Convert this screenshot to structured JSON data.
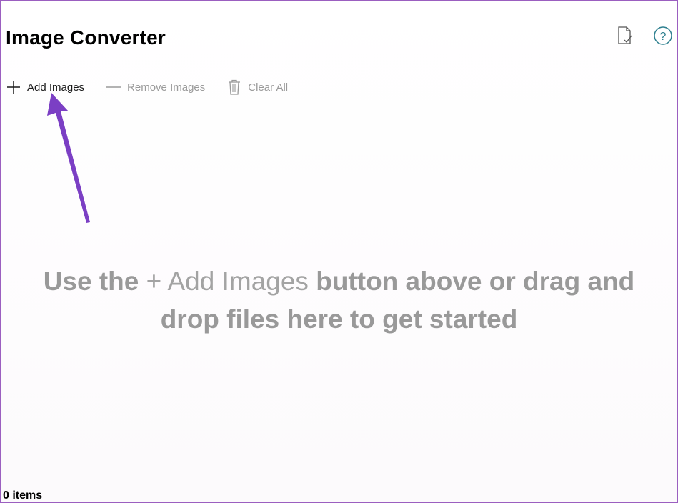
{
  "app": {
    "title": "Image Converter"
  },
  "header": {
    "icons": [
      "document-icon",
      "help-icon"
    ]
  },
  "toolbar": {
    "add_label": "Add Images",
    "remove_label": "Remove Images",
    "clear_label": "Clear All",
    "add_enabled": true,
    "remove_enabled": false,
    "clear_enabled": false
  },
  "empty_state": {
    "line1_a": "Use the",
    "line1_b": "+ Add Images",
    "line1_c": "button above or drag and",
    "line2": "drop files here to get started"
  },
  "status": {
    "count_text": "0 items"
  },
  "colors": {
    "border": "#9b5fc0",
    "annotation_arrow": "#7b3fc4",
    "disabled_text": "#9a9a9a",
    "help_icon": "#2d7f8f"
  }
}
